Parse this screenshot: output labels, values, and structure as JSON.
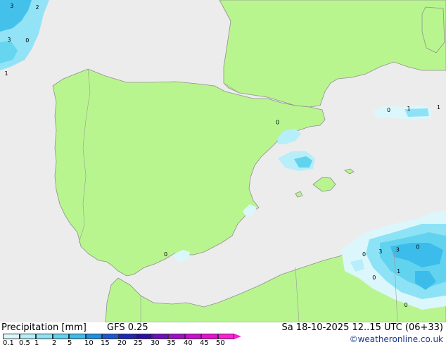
{
  "footer": {
    "title": "Precipitation [mm]",
    "model": "GFS 0.25",
    "timestamp": "Sa 18-10-2025 12..15 UTC (06+33)",
    "credit": "©weatheronline.co.uk"
  },
  "scale": {
    "labels": [
      "0.1",
      "0.5",
      "1",
      "2",
      "5",
      "10",
      "15",
      "20",
      "25",
      "30",
      "35",
      "40",
      "45",
      "50"
    ],
    "colors": [
      "#dcf7fb",
      "#b6eef9",
      "#8de3f5",
      "#62d3ef",
      "#3cbcea",
      "#1f8fe0",
      "#1d58d0",
      "#1f27b6",
      "#2c0fa0",
      "#6e10b9",
      "#a010c6",
      "#c90fd0",
      "#e611cf",
      "#ff1fd6"
    ]
  },
  "map_labels": [
    {
      "text": "3",
      "lon": -11.55,
      "lat": 44.85
    },
    {
      "text": "2",
      "lon": -10.15,
      "lat": 44.8
    },
    {
      "text": "3",
      "lon": -11.7,
      "lat": 43.75
    },
    {
      "text": "0",
      "lon": -10.7,
      "lat": 43.72
    },
    {
      "text": "1",
      "lon": -11.85,
      "lat": 42.65
    },
    {
      "text": "0",
      "lon": 3.05,
      "lat": 41.05
    },
    {
      "text": "0",
      "lon": 9.15,
      "lat": 41.45
    },
    {
      "text": "1",
      "lon": 10.25,
      "lat": 41.5
    },
    {
      "text": "1",
      "lon": 11.9,
      "lat": 41.55
    },
    {
      "text": "0",
      "lon": -3.1,
      "lat": 36.75
    },
    {
      "text": "0",
      "lon": 7.8,
      "lat": 36.75
    },
    {
      "text": "3",
      "lon": 8.7,
      "lat": 36.85
    },
    {
      "text": "3",
      "lon": 9.65,
      "lat": 36.9
    },
    {
      "text": "0",
      "lon": 10.75,
      "lat": 37.0
    },
    {
      "text": "1",
      "lon": 9.7,
      "lat": 36.2
    },
    {
      "text": "0",
      "lon": 8.35,
      "lat": 36.0
    },
    {
      "text": "0",
      "lon": 10.1,
      "lat": 35.1
    }
  ]
}
